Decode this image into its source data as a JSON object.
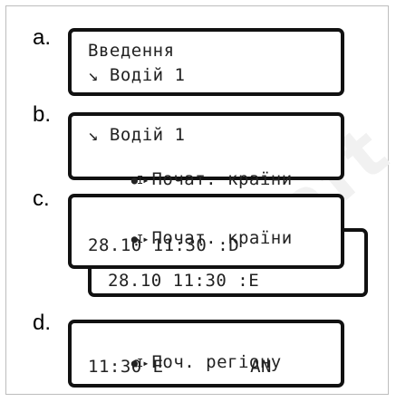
{
  "steps": [
    {
      "letter": "a.",
      "lines": [
        "Введення",
        "↘ Водій 1"
      ]
    },
    {
      "letter": "b.",
      "lines": [
        "↘ Водій 1",
        "Почат. країни"
      ],
      "line2_icon": "●I▸"
    },
    {
      "letter": "c.",
      "lines": [
        "Почат. країни",
        "28.10 11:30 :D"
      ],
      "line1_icon": "●I▸",
      "back_line": "28.10 11:30 :E"
    },
    {
      "letter": "d.",
      "lines": [
        "Поч. регіону",
        "11:30 E        AN"
      ],
      "line1_icon": "●I▸"
    }
  ],
  "watermark_text": "draft"
}
